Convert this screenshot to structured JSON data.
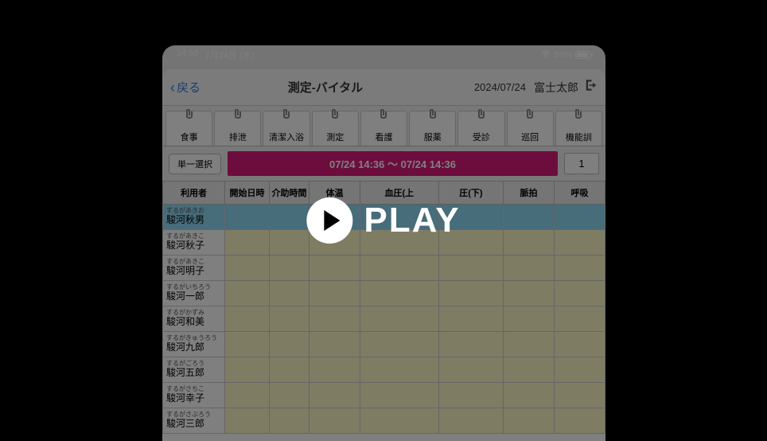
{
  "status": {
    "time": "14:58",
    "date": "7月24日 (水)",
    "battery_pct": "80%"
  },
  "header": {
    "back": "戻る",
    "title": "測定-バイタル",
    "date": "2024/07/24",
    "user": "富士太郎"
  },
  "tabs": [
    "食事",
    "排泄",
    "清潔入浴",
    "測定",
    "看護",
    "服薬",
    "受診",
    "巡回",
    "機能訓"
  ],
  "toolbar": {
    "select_mode": "単一選択",
    "datetime": "07/24 14:36 ～ 07/24 14:36",
    "count": "1"
  },
  "columns": [
    "利用者",
    "開始日時",
    "介助時間",
    "体温",
    "血圧(上",
    "圧(下)",
    "脈拍",
    "呼吸"
  ],
  "rows": [
    {
      "ruby": "するがあきお",
      "name": "駿河秋男",
      "selected": true
    },
    {
      "ruby": "するがあきこ",
      "name": "駿河秋子",
      "selected": false
    },
    {
      "ruby": "するがあきこ",
      "name": "駿河明子",
      "selected": false
    },
    {
      "ruby": "するがいちろう",
      "name": "駿河一郎",
      "selected": false
    },
    {
      "ruby": "するがかずみ",
      "name": "駿河和美",
      "selected": false
    },
    {
      "ruby": "するがきゅうろう",
      "name": "駿河九郎",
      "selected": false
    },
    {
      "ruby": "するがごろう",
      "name": "駿河五郎",
      "selected": false
    },
    {
      "ruby": "するがさちこ",
      "name": "駿河幸子",
      "selected": false
    },
    {
      "ruby": "するがさぶろう",
      "name": "駿河三郎",
      "selected": false
    }
  ],
  "overlay": {
    "play": "PLAY"
  }
}
